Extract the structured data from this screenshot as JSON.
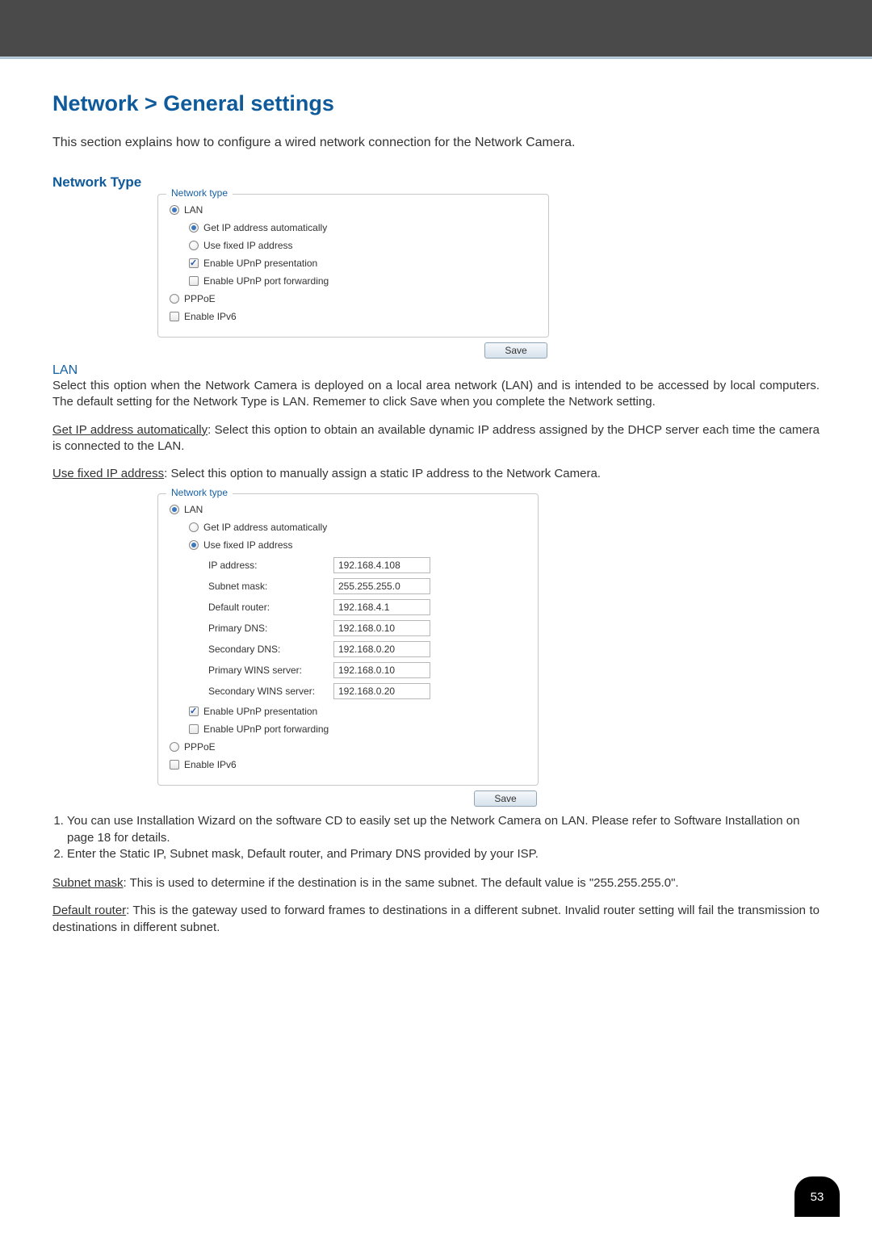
{
  "page": {
    "title": "Network > General settings",
    "intro": "This section explains how to configure a wired network connection for the Network Camera.",
    "section": "Network Type",
    "page_number": "53"
  },
  "figure1": {
    "legend": "Network type",
    "lan": "LAN",
    "get_ip": "Get IP address automatically",
    "fixed_ip": "Use fixed IP address",
    "upnp_pres": "Enable UPnP presentation",
    "upnp_port": "Enable UPnP port forwarding",
    "pppoe": "PPPoE",
    "ipv6": "Enable IPv6",
    "save": "Save"
  },
  "lan_block": {
    "heading": "LAN",
    "para1": "Select this option when the Network Camera is deployed on a local area network (LAN) and is intended to be accessed by local computers. The default setting for the Network Type is LAN. Rememer to click Save when you complete the Network setting.",
    "get_ip_link": "Get IP address automatically",
    "get_ip_rest": ": Select this option to obtain an available dynamic IP address assigned by the DHCP server each time the camera is connected to the LAN.",
    "fixed_ip_link": "Use fixed IP address",
    "fixed_ip_rest": ": Select this option to manually assign a static IP address to the Network Camera."
  },
  "figure2": {
    "legend": "Network type",
    "lan": "LAN",
    "get_ip": "Get IP address automatically",
    "fixed_ip": "Use fixed IP address",
    "fields": {
      "ip_label": "IP address:",
      "ip_val": "192.168.4.108",
      "subnet_label": "Subnet mask:",
      "subnet_val": "255.255.255.0",
      "router_label": "Default router:",
      "router_val": "192.168.4.1",
      "pdns_label": "Primary DNS:",
      "pdns_val": "192.168.0.10",
      "sdns_label": "Secondary DNS:",
      "sdns_val": "192.168.0.20",
      "pwins_label": "Primary WINS server:",
      "pwins_val": "192.168.0.10",
      "swins_label": "Secondary WINS server:",
      "swins_val": "192.168.0.20"
    },
    "upnp_pres": "Enable UPnP presentation",
    "upnp_port": "Enable UPnP port forwarding",
    "pppoe": "PPPoE",
    "ipv6": "Enable IPv6",
    "save": "Save"
  },
  "list": {
    "item1": "You can use Installation Wizard on the software CD to easily set up the Network Camera on LAN. Please refer to Software Installation on page 18 for details.",
    "item2": "Enter the Static IP, Subnet mask, Default router, and Primary DNS provided by your ISP."
  },
  "subnet": {
    "link": "Subnet mask",
    "rest": ": This is used to determine if the destination is in the same subnet. The default value is \"255.255.255.0\"."
  },
  "router": {
    "link": "Default router",
    "rest": ": This is the gateway used to forward frames to destinations in a different subnet. Invalid router setting will fail the transmission to destinations in different subnet."
  }
}
